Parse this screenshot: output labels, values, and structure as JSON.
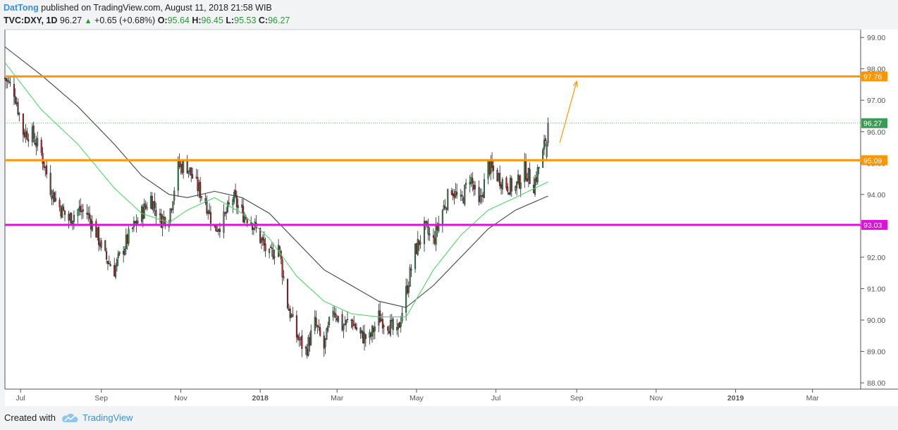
{
  "header": {
    "author": "DatTong",
    "published": " published on TradingView.com, August 11, 2018 21:58 WIB",
    "symbol": "TVC:DXY, 1D",
    "last": "96.27",
    "up_arrow": "▲",
    "change": "+0.65 (+0.68%)",
    "o_label": "O:",
    "o_val": "95.64",
    "h_label": "H:",
    "h_val": "96.45",
    "l_label": "L:",
    "l_val": "95.53",
    "c_label": "C:",
    "c_val": "96.27"
  },
  "footer": {
    "created_with": "Created with",
    "brand": "TradingView",
    "logo_icon": "tradingview-cloud-icon"
  },
  "colors": {
    "up_candle": "#3c9a57",
    "down_candle": "#b8242e",
    "candle_outline": "#222222",
    "level_orange": "#ff9500",
    "level_magenta": "#e00fe0",
    "ma_green": "#4cd964",
    "ma_dark": "#444444",
    "last_price_label": "#3c9a57"
  },
  "chart_data": {
    "type": "candlestick",
    "symbol": "TVC:DXY",
    "timeframe": "1D",
    "y_range": [
      87.8,
      99.25
    ],
    "y_ticks": [
      "99.00",
      "98.00",
      "97.00",
      "96.00",
      "95.00",
      "94.00",
      "93.00",
      "92.00",
      "91.00",
      "90.00",
      "89.00",
      "88.00"
    ],
    "x_ticks": [
      "Jul",
      "Sep",
      "Nov",
      "2018",
      "Mar",
      "May",
      "Jul",
      "Sep",
      "Nov",
      "2019",
      "Mar"
    ],
    "x_tick_dates": [
      "2017-07-01",
      "2017-09-01",
      "2017-11-01",
      "2018-01-01",
      "2018-03-01",
      "2018-05-01",
      "2018-07-01",
      "2018-09-01",
      "2018-11-01",
      "2019-01-01",
      "2019-03-01"
    ],
    "x_range": [
      "2017-06-19",
      "2019-04-07"
    ],
    "horizontal_levels": [
      {
        "value": 97.76,
        "label": "97.76",
        "color": "#ff9500"
      },
      {
        "value": 95.09,
        "label": "95.09",
        "color": "#ff9500"
      },
      {
        "value": 93.03,
        "label": "93.03",
        "color": "#e00fe0"
      }
    ],
    "last_price": {
      "value": 96.27,
      "label": "96.27"
    },
    "projection_arrow": {
      "from": {
        "date": "2018-08-19",
        "price": 95.65
      },
      "to": {
        "date": "2018-09-01",
        "price": 97.6
      }
    },
    "close_path": [
      [
        "2017-06-19",
        97.7
      ],
      [
        "2017-06-26",
        97.3
      ],
      [
        "2017-07-03",
        96.0
      ],
      [
        "2017-07-10",
        95.9
      ],
      [
        "2017-07-17",
        95.3
      ],
      [
        "2017-07-24",
        94.2
      ],
      [
        "2017-07-31",
        93.6
      ],
      [
        "2017-08-07",
        93.2
      ],
      [
        "2017-08-14",
        93.5
      ],
      [
        "2017-08-21",
        93.4
      ],
      [
        "2017-08-28",
        92.8
      ],
      [
        "2017-09-04",
        92.0
      ],
      [
        "2017-09-11",
        91.6
      ],
      [
        "2017-09-18",
        92.3
      ],
      [
        "2017-09-25",
        92.9
      ],
      [
        "2017-10-02",
        93.4
      ],
      [
        "2017-10-09",
        93.9
      ],
      [
        "2017-10-16",
        93.2
      ],
      [
        "2017-10-23",
        93.3
      ],
      [
        "2017-10-30",
        94.9
      ],
      [
        "2017-11-06",
        94.9
      ],
      [
        "2017-11-13",
        94.3
      ],
      [
        "2017-11-20",
        93.8
      ],
      [
        "2017-11-27",
        92.9
      ],
      [
        "2017-12-04",
        93.2
      ],
      [
        "2017-12-11",
        93.9
      ],
      [
        "2017-12-18",
        93.4
      ],
      [
        "2017-12-25",
        93.2
      ],
      [
        "2018-01-01",
        92.6
      ],
      [
        "2018-01-08",
        92.0
      ],
      [
        "2018-01-15",
        92.4
      ],
      [
        "2018-01-22",
        90.5
      ],
      [
        "2018-01-29",
        89.5
      ],
      [
        "2018-02-05",
        89.0
      ],
      [
        "2018-02-12",
        89.9
      ],
      [
        "2018-02-19",
        89.1
      ],
      [
        "2018-02-26",
        90.4
      ],
      [
        "2018-03-05",
        89.8
      ],
      [
        "2018-03-12",
        90.0
      ],
      [
        "2018-03-19",
        89.5
      ],
      [
        "2018-03-26",
        89.4
      ],
      [
        "2018-04-02",
        90.1
      ],
      [
        "2018-04-09",
        89.9
      ],
      [
        "2018-04-16",
        89.5
      ],
      [
        "2018-04-23",
        90.9
      ],
      [
        "2018-04-30",
        92.2
      ],
      [
        "2018-05-07",
        92.9
      ],
      [
        "2018-05-14",
        92.5
      ],
      [
        "2018-05-21",
        93.5
      ],
      [
        "2018-05-28",
        94.2
      ],
      [
        "2018-06-04",
        93.7
      ],
      [
        "2018-06-11",
        94.6
      ],
      [
        "2018-06-18",
        93.6
      ],
      [
        "2018-06-25",
        94.9
      ],
      [
        "2018-07-02",
        94.6
      ],
      [
        "2018-07-09",
        94.3
      ],
      [
        "2018-07-16",
        94.2
      ],
      [
        "2018-07-23",
        94.8
      ],
      [
        "2018-07-30",
        94.3
      ],
      [
        "2018-08-06",
        95.3
      ],
      [
        "2018-08-10",
        96.27
      ]
    ],
    "ma_fast": [
      [
        "2017-06-19",
        98.2
      ],
      [
        "2017-07-17",
        96.7
      ],
      [
        "2017-08-14",
        95.6
      ],
      [
        "2017-09-11",
        94.2
      ],
      [
        "2017-10-02",
        93.4
      ],
      [
        "2017-10-23",
        93.1
      ],
      [
        "2017-11-06",
        93.5
      ],
      [
        "2017-11-27",
        93.9
      ],
      [
        "2017-12-18",
        93.4
      ],
      [
        "2018-01-08",
        92.6
      ],
      [
        "2018-01-29",
        91.4
      ],
      [
        "2018-02-19",
        90.6
      ],
      [
        "2018-03-12",
        90.2
      ],
      [
        "2018-04-02",
        90.1
      ],
      [
        "2018-04-23",
        90.1
      ],
      [
        "2018-05-14",
        91.6
      ],
      [
        "2018-06-04",
        92.7
      ],
      [
        "2018-06-25",
        93.5
      ],
      [
        "2018-07-16",
        93.9
      ],
      [
        "2018-08-10",
        94.4
      ]
    ],
    "ma_slow": [
      [
        "2017-06-19",
        98.7
      ],
      [
        "2017-07-17",
        97.8
      ],
      [
        "2017-08-14",
        96.8
      ],
      [
        "2017-09-11",
        95.6
      ],
      [
        "2017-10-02",
        94.6
      ],
      [
        "2017-10-23",
        94.0
      ],
      [
        "2017-11-06",
        93.9
      ],
      [
        "2017-11-27",
        94.1
      ],
      [
        "2017-12-18",
        93.9
      ],
      [
        "2018-01-08",
        93.4
      ],
      [
        "2018-01-29",
        92.5
      ],
      [
        "2018-02-19",
        91.6
      ],
      [
        "2018-03-12",
        91.1
      ],
      [
        "2018-04-02",
        90.6
      ],
      [
        "2018-04-23",
        90.4
      ],
      [
        "2018-05-14",
        91.1
      ],
      [
        "2018-06-04",
        92.0
      ],
      [
        "2018-06-25",
        92.9
      ],
      [
        "2018-07-16",
        93.5
      ],
      [
        "2018-08-10",
        93.95
      ]
    ]
  }
}
